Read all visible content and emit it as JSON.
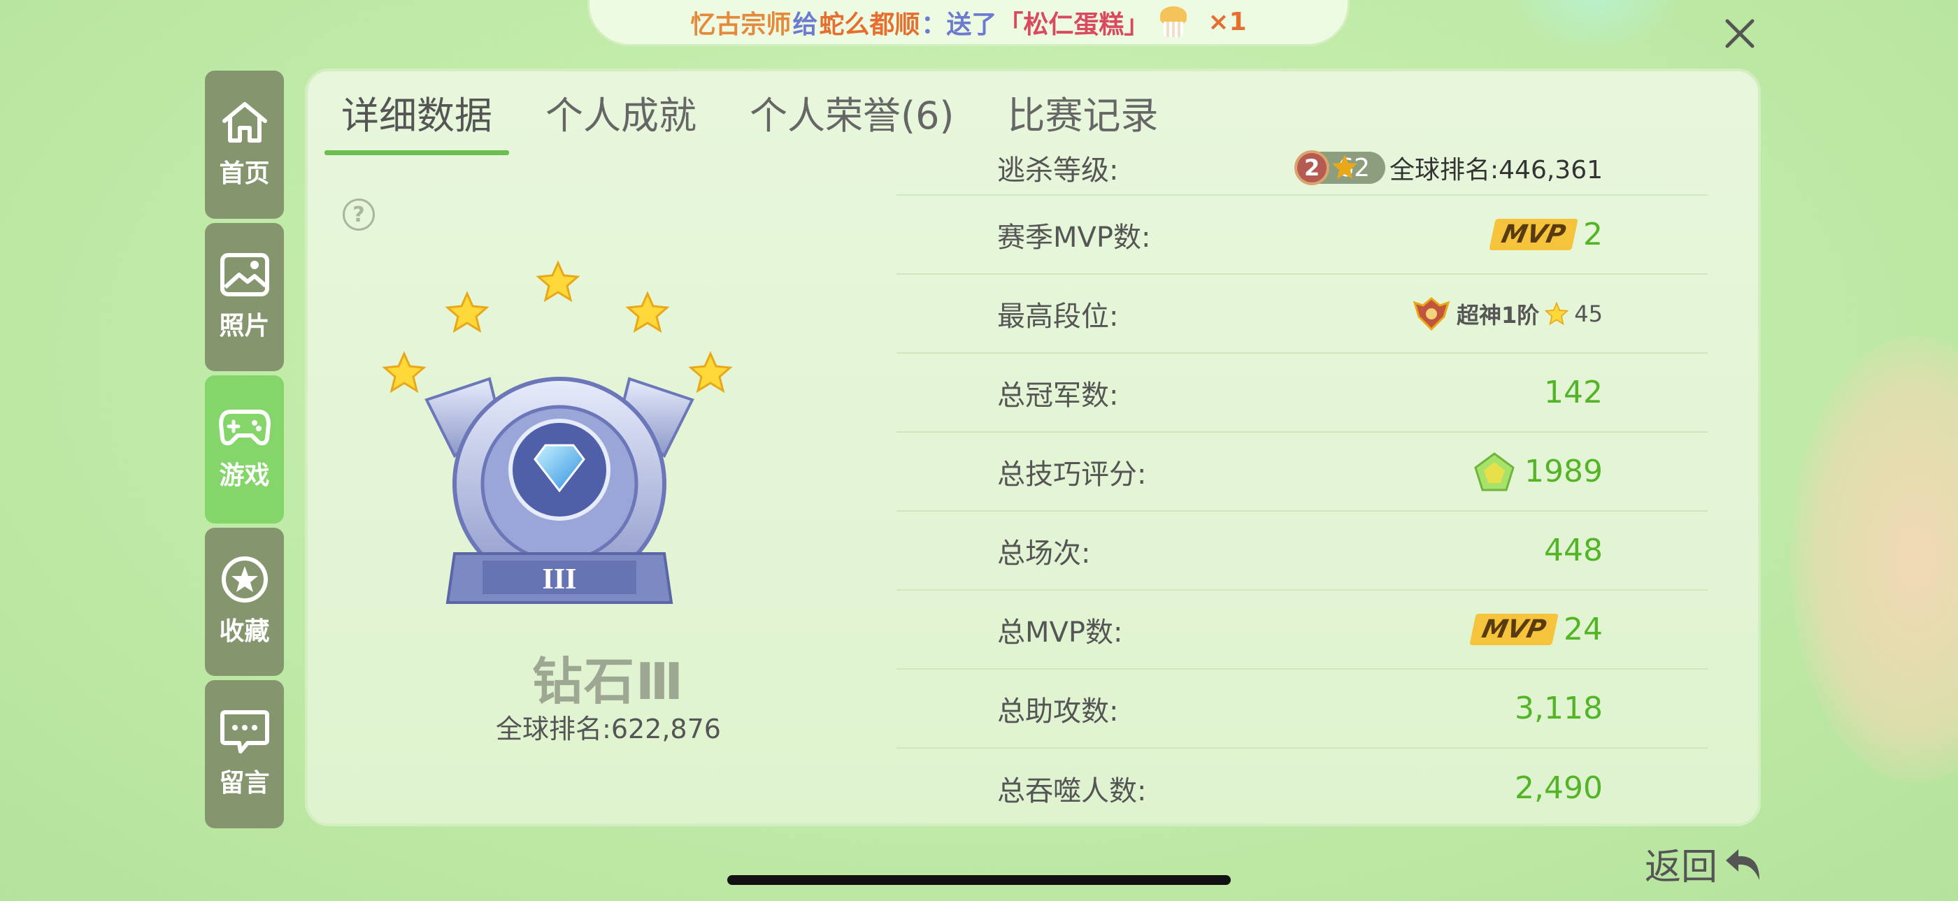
{
  "banner": {
    "sender": "忆古宗师",
    "to_word": "给",
    "receiver": "蛇么都顺",
    "action": "：送了",
    "gift": "「松仁蛋糕」",
    "count": "×1"
  },
  "sidebar": {
    "items": [
      {
        "label": "首页",
        "icon": "home-icon"
      },
      {
        "label": "照片",
        "icon": "photo-icon"
      },
      {
        "label": "游戏",
        "icon": "gamepad-icon"
      },
      {
        "label": "收藏",
        "icon": "star-icon"
      },
      {
        "label": "留言",
        "icon": "message-icon"
      }
    ],
    "active": "游戏"
  },
  "tabs": [
    "详细数据",
    "个人成就",
    "个人荣誉(6)",
    "比赛记录"
  ],
  "rank": {
    "name": "钻石Ⅲ",
    "roman": "III",
    "global_rank": "全球排名:622,876",
    "stars": 5
  },
  "stats": [
    {
      "label": "逃杀等级:",
      "level": "2",
      "level_stars": "62",
      "global": "全球排名:446,361"
    },
    {
      "label": "赛季MVP数:",
      "mvp_tag": "MVP",
      "value": "2"
    },
    {
      "label": "最高段位:",
      "tier": "超神1阶",
      "tier_stars": "45"
    },
    {
      "label": "总冠军数:",
      "value": "142"
    },
    {
      "label": "总技巧评分:",
      "value": "1989"
    },
    {
      "label": "总场次:",
      "value": "448"
    },
    {
      "label": "总MVP数:",
      "mvp_tag": "MVP",
      "value": "24"
    },
    {
      "label": "总助攻数:",
      "value": "3,118"
    },
    {
      "label": "总吞噬人数:",
      "value": "2,490"
    }
  ],
  "back_label": "返回",
  "colors": {
    "accent": "#52b426",
    "sidebar": "#85966e",
    "sidebar_active": "#85d66a"
  }
}
